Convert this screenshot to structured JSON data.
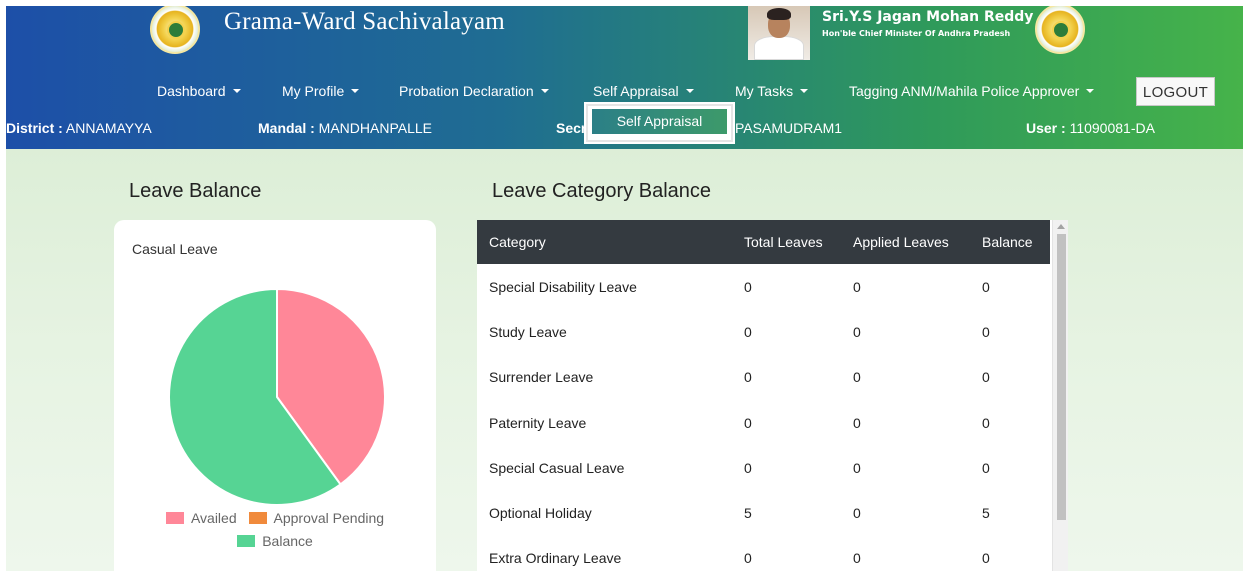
{
  "header": {
    "app_title": "Grama-Ward Sachivalayam",
    "cm_name": "Sri.Y.S Jagan Mohan Reddy",
    "cm_title": "Hon'ble Chief Minister Of Andhra Pradesh"
  },
  "nav": {
    "items": [
      {
        "label": "Dashboard"
      },
      {
        "label": "My Profile"
      },
      {
        "label": "Probation Declaration"
      },
      {
        "label": "Self Appraisal"
      },
      {
        "label": "My Tasks"
      },
      {
        "label": "Tagging ANM/Mahila Police Approver"
      }
    ],
    "logout_label": "LOGOUT",
    "dropdown_item": "Self Appraisal"
  },
  "info": {
    "district_label": "District :",
    "district_value": "ANNAMAYYA",
    "mandal_label": "Mandal :",
    "mandal_value": "MANDHANPALLE",
    "secretariat_label": "Secr",
    "secretariat_value": "PASAMUDRAM1",
    "user_label": "User :",
    "user_value": "11090081-DA"
  },
  "leave_balance": {
    "title": "Leave Balance",
    "card_title": "Casual Leave",
    "legend": [
      {
        "label": "Availed",
        "color": "#ff8798"
      },
      {
        "label": "Approval Pending",
        "color": "#f08a3c"
      },
      {
        "label": "Balance",
        "color": "#56d494"
      }
    ],
    "chart_data": {
      "type": "pie",
      "categories": [
        "Availed",
        "Approval Pending",
        "Balance"
      ],
      "values": [
        40,
        0,
        60
      ],
      "colors": [
        "#ff8798",
        "#f08a3c",
        "#56d494"
      ],
      "legend_position": "bottom"
    }
  },
  "leave_category": {
    "title": "Leave Category Balance",
    "columns": [
      "Category",
      "Total Leaves",
      "Applied Leaves",
      "Balance"
    ],
    "rows": [
      [
        "Special Disability Leave",
        "0",
        "0",
        "0"
      ],
      [
        "Study Leave",
        "0",
        "0",
        "0"
      ],
      [
        "Surrender Leave",
        "0",
        "0",
        "0"
      ],
      [
        "Paternity Leave",
        "0",
        "0",
        "0"
      ],
      [
        "Special Casual Leave",
        "0",
        "0",
        "0"
      ],
      [
        "Optional Holiday",
        "5",
        "0",
        "5"
      ],
      [
        "Extra Ordinary Leave",
        "0",
        "0",
        "0"
      ]
    ]
  },
  "colors": {
    "header_start": "#1d4fa8",
    "header_end": "#46b34a",
    "table_header": "#343a40"
  }
}
